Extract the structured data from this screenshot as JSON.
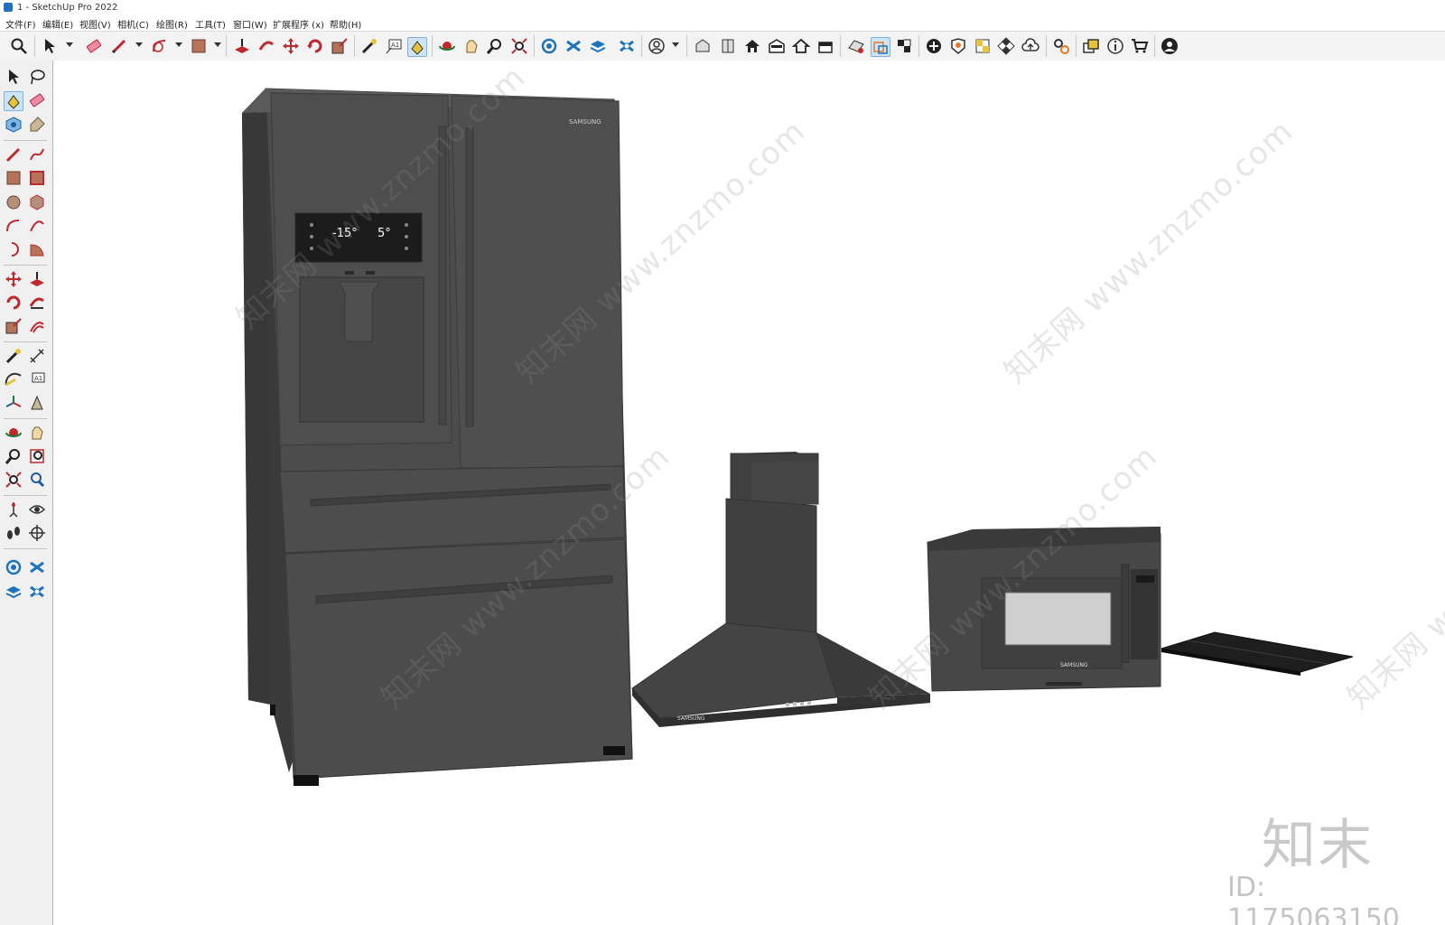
{
  "window": {
    "title": "1 - SketchUp Pro 2022"
  },
  "menu": {
    "items": [
      "文件(F)",
      "编辑(E)",
      "视图(V)",
      "相机(C)",
      "绘图(R)",
      "工具(T)",
      "窗口(W)",
      "扩展程序 (x)",
      "帮助(H)"
    ]
  },
  "scene": {
    "fridge_brand": "SAMSUNG",
    "fridge_temp_left": "-15°",
    "fridge_temp_right": "5°",
    "hood_brand": "SAMSUNG",
    "microwave_brand": "SAMSUNG"
  },
  "watermark": {
    "site": "知末网 www.znzmo.com",
    "logo": "知末",
    "id": "ID: 1175063150"
  },
  "icons": {
    "toolbar": [
      "search-icon",
      "select-icon",
      "eraser-icon",
      "pencil-icon",
      "arc-icon",
      "paint-icon",
      "pushpull-icon",
      "followme-icon",
      "move-icon",
      "rotate-icon",
      "scale-icon",
      "tape-icon",
      "text-icon",
      "paint-bucket-icon",
      "orbit-icon",
      "pan-icon",
      "zoom-icon",
      "zoom-extents-icon",
      "warehouse-icon",
      "extension-icon",
      "layers-icon",
      "component-icon",
      "user-icon",
      "iso-view-icon",
      "top-view-icon",
      "front-view-icon",
      "right-view-icon",
      "back-view-icon",
      "left-view-icon",
      "section-icon",
      "section-display-icon",
      "section-fill-icon",
      "add-location-icon",
      "shadow-icon",
      "fog-icon",
      "style-icon",
      "cloud-icon",
      "settings-icon",
      "outliner-icon",
      "info-icon",
      "cart-icon",
      "account-icon"
    ]
  }
}
